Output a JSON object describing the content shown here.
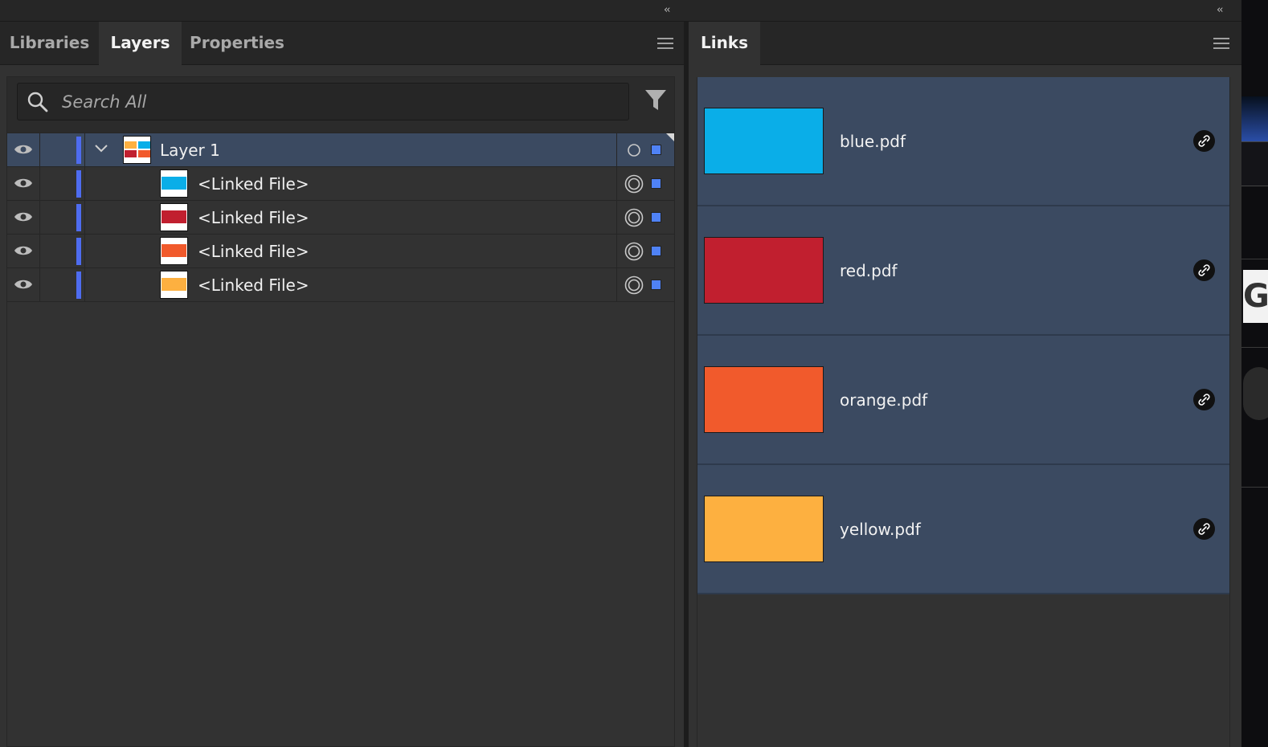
{
  "left_panel": {
    "tabs": [
      {
        "label": "Libraries",
        "active": false
      },
      {
        "label": "Layers",
        "active": true
      },
      {
        "label": "Properties",
        "active": false
      }
    ],
    "search": {
      "placeholder": "Search All"
    },
    "layers": [
      {
        "name": "Layer 1",
        "type": "layer",
        "expanded": true,
        "selected": true,
        "visible": true
      },
      {
        "name": "<Linked File>",
        "type": "item",
        "color": "#0aaee8",
        "visible": true
      },
      {
        "name": "<Linked File>",
        "type": "item",
        "color": "#c11f2f",
        "visible": true
      },
      {
        "name": "<Linked File>",
        "type": "item",
        "color": "#f15a2c",
        "visible": true
      },
      {
        "name": "<Linked File>",
        "type": "item",
        "color": "#fdb040",
        "visible": true
      }
    ]
  },
  "right_panel": {
    "tab": "Links",
    "links": [
      {
        "name": "blue.pdf",
        "color": "#0aaee8"
      },
      {
        "name": "red.pdf",
        "color": "#c11f2f"
      },
      {
        "name": "orange.pdf",
        "color": "#f15a2c"
      },
      {
        "name": "yellow.pdf",
        "color": "#fdb040"
      }
    ]
  },
  "colors": {
    "selected_row": "#3b4a61",
    "layer_color": "#4e6cf0"
  },
  "icons": {
    "collapse": "double-chevron-left-icon",
    "menu": "hamburger-menu-icon",
    "search": "search-icon",
    "filter": "funnel-filter-icon",
    "visibility": "eye-icon",
    "expand": "chevron-down-icon",
    "target": "target-icon",
    "link": "link-icon"
  },
  "external": {
    "strip_glyph": "G"
  }
}
